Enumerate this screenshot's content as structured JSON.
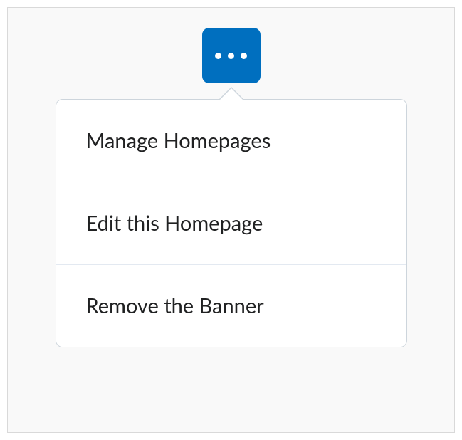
{
  "menu": {
    "items": [
      {
        "label": "Manage Homepages"
      },
      {
        "label": "Edit this Homepage"
      },
      {
        "label": "Remove the Banner"
      }
    ]
  }
}
